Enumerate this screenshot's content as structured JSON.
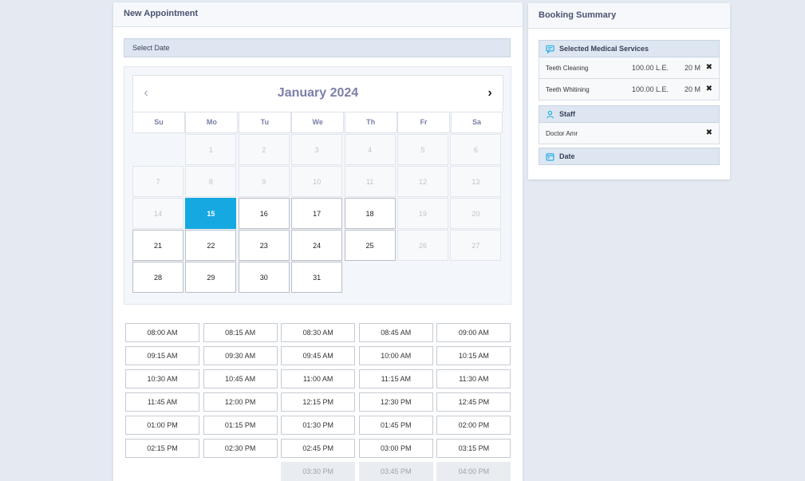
{
  "appointment": {
    "title": "New Appointment",
    "select_date_label": "Select Date",
    "calendar": {
      "month_label": "January 2024",
      "prev_icon": "‹",
      "next_icon": "›",
      "weekdays": [
        "Su",
        "Mo",
        "Tu",
        "We",
        "Th",
        "Fr",
        "Sa"
      ],
      "leading_blanks": 1,
      "days": [
        {
          "n": "1",
          "state": "disabled"
        },
        {
          "n": "2",
          "state": "disabled"
        },
        {
          "n": "3",
          "state": "disabled"
        },
        {
          "n": "4",
          "state": "disabled"
        },
        {
          "n": "5",
          "state": "disabled"
        },
        {
          "n": "6",
          "state": "disabled"
        },
        {
          "n": "7",
          "state": "disabled"
        },
        {
          "n": "8",
          "state": "disabled"
        },
        {
          "n": "9",
          "state": "disabled"
        },
        {
          "n": "10",
          "state": "disabled"
        },
        {
          "n": "11",
          "state": "disabled"
        },
        {
          "n": "12",
          "state": "disabled"
        },
        {
          "n": "13",
          "state": "disabled"
        },
        {
          "n": "14",
          "state": "disabled"
        },
        {
          "n": "15",
          "state": "selected"
        },
        {
          "n": "16",
          "state": "avail"
        },
        {
          "n": "17",
          "state": "avail"
        },
        {
          "n": "18",
          "state": "avail"
        },
        {
          "n": "19",
          "state": "disabled"
        },
        {
          "n": "20",
          "state": "disabled"
        },
        {
          "n": "21",
          "state": "avail"
        },
        {
          "n": "22",
          "state": "avail"
        },
        {
          "n": "23",
          "state": "avail"
        },
        {
          "n": "24",
          "state": "avail"
        },
        {
          "n": "25",
          "state": "avail"
        },
        {
          "n": "26",
          "state": "disabled"
        },
        {
          "n": "27",
          "state": "disabled"
        },
        {
          "n": "28",
          "state": "avail"
        },
        {
          "n": "29",
          "state": "avail"
        },
        {
          "n": "30",
          "state": "avail"
        },
        {
          "n": "31",
          "state": "avail"
        }
      ]
    },
    "time_slots": [
      {
        "t": "08:00 AM",
        "s": "avail"
      },
      {
        "t": "08:15 AM",
        "s": "avail"
      },
      {
        "t": "08:30 AM",
        "s": "avail"
      },
      {
        "t": "08:45 AM",
        "s": "avail"
      },
      {
        "t": "09:00 AM",
        "s": "avail"
      },
      {
        "t": "09:15 AM",
        "s": "avail"
      },
      {
        "t": "09:30 AM",
        "s": "avail"
      },
      {
        "t": "09:45 AM",
        "s": "avail"
      },
      {
        "t": "10:00 AM",
        "s": "avail"
      },
      {
        "t": "10:15 AM",
        "s": "avail"
      },
      {
        "t": "10:30 AM",
        "s": "avail"
      },
      {
        "t": "10:45 AM",
        "s": "avail"
      },
      {
        "t": "11:00 AM",
        "s": "avail"
      },
      {
        "t": "11:15 AM",
        "s": "avail"
      },
      {
        "t": "11:30 AM",
        "s": "avail"
      },
      {
        "t": "11:45 AM",
        "s": "avail"
      },
      {
        "t": "12:00 PM",
        "s": "avail"
      },
      {
        "t": "12:15 PM",
        "s": "avail"
      },
      {
        "t": "12:30 PM",
        "s": "avail"
      },
      {
        "t": "12:45 PM",
        "s": "avail"
      },
      {
        "t": "01:00 PM",
        "s": "avail"
      },
      {
        "t": "01:15 PM",
        "s": "avail"
      },
      {
        "t": "01:30 PM",
        "s": "avail"
      },
      {
        "t": "01:45 PM",
        "s": "avail"
      },
      {
        "t": "02:00 PM",
        "s": "avail"
      },
      {
        "t": "02:15 PM",
        "s": "avail"
      },
      {
        "t": "02:30 PM",
        "s": "avail"
      },
      {
        "t": "02:45 PM",
        "s": "avail"
      },
      {
        "t": "03:00 PM",
        "s": "avail"
      },
      {
        "t": "03:15 PM",
        "s": "avail"
      },
      {
        "t": "",
        "s": "blank"
      },
      {
        "t": "",
        "s": "blank"
      },
      {
        "t": "03:30 PM",
        "s": "disabled"
      },
      {
        "t": "03:45 PM",
        "s": "disabled"
      },
      {
        "t": "04:00 PM",
        "s": "disabled"
      }
    ]
  },
  "summary": {
    "title": "Booking Summary",
    "services_label": "Selected Medical Services",
    "services": [
      {
        "name": "Teeth Cleaning",
        "price": "100.00 L.E.",
        "duration": "20 M"
      },
      {
        "name": "Teeth Whitining",
        "price": "100.00 L.E.",
        "duration": "20 M"
      }
    ],
    "staff_label": "Staff",
    "staff_name": "Doctor Amr",
    "date_label": "Date",
    "remove_icon": "✖"
  },
  "colors": {
    "accent": "#16a8e0",
    "header_text": "#7a7fa8"
  }
}
